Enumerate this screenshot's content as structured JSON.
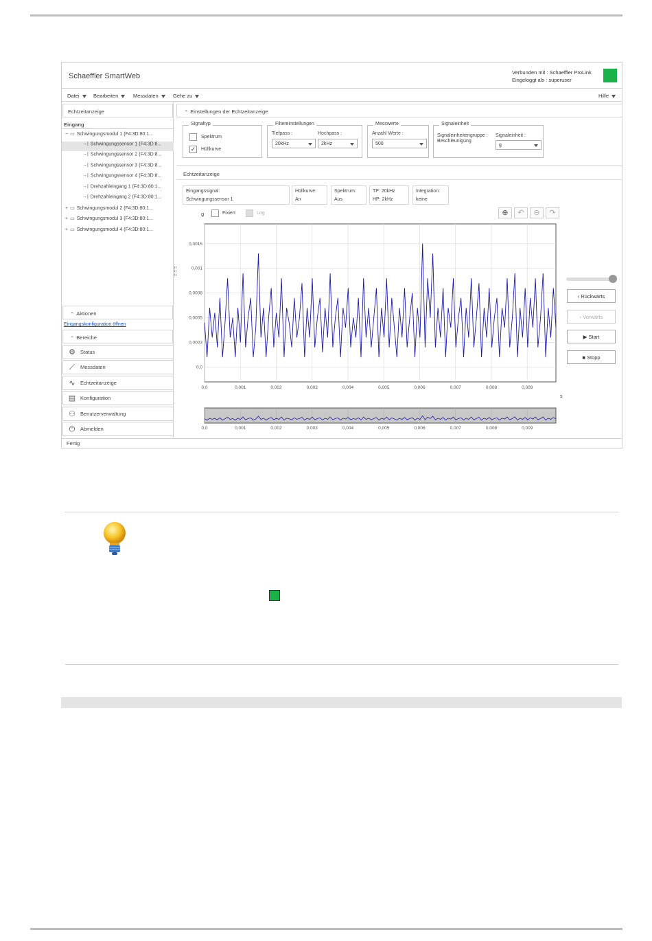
{
  "app": {
    "title": "Schaeffler SmartWeb",
    "connected_label": "Verbunden mit : Schaeffler ProLink",
    "logged_label": "Eingeloggt als : superuser",
    "status_color": "#1bb24a",
    "status_text": "Fertig"
  },
  "menu": {
    "items": [
      "Datei",
      "Bearbeiten",
      "Messdaten",
      "Gehe zu"
    ],
    "help": "Hilfe"
  },
  "left": {
    "header": "Echtzeitanzeige",
    "section": "Eingang",
    "tree": [
      "Schwingungsmodul 1 (F4:3D:80:1...",
      "Schwingungssensor 1 (F4:3D:8...",
      "Schwingungssensor 2 (F4:3D:8...",
      "Schwingungssensor 3 (F4:3D:8...",
      "Schwingungssensor 4 (F4:3D:8...",
      "Drehzahleingang 1 (F4:3D:80:1...",
      "Drehzahleingang 2 (F4:3D:80:1...",
      "Schwingungsmodul 2 (F4:3D:80:1...",
      "Schwingungsmodul 3 (F4:3D:80:1...",
      "Schwingungsmodul 4 (F4:3D:80:1..."
    ],
    "actions": "Aktionen",
    "config_link": "Eingangskonfiguration öffnen",
    "areas": "Bereiche",
    "nav": [
      "Status",
      "Messdaten",
      "Echtzeitanzeige",
      "Konfiguration",
      "Benutzerverwaltung",
      "Abmelden"
    ]
  },
  "settings": {
    "header": "Einstellungen der Echtzeitanzeige",
    "signaltyp": {
      "title": "Signaltyp",
      "spektrum": "Spektrum",
      "huellkurve": "Hüllkurve",
      "spektrum_checked": false,
      "huellkurve_checked": true
    },
    "filter": {
      "title": "Filtereinstellungen",
      "tiefpass_label": "Tiefpass :",
      "tiefpass_value": "20kHz",
      "hochpass_label": "Hochpass :",
      "hochpass_value": "2kHz"
    },
    "messwerte": {
      "title": "Messwerte",
      "anzahl_label": "Anzahl Werte :",
      "anzahl_value": "500"
    },
    "einheit": {
      "title": "Signaleinheit",
      "gruppe_label": "Signaleinheitengruppe :",
      "gruppe_value": "Beschleunigung",
      "einheit_label": "Signaleinheit :",
      "einheit_value": "g"
    }
  },
  "realtime": {
    "header": "Echtzeitanzeige",
    "info": [
      {
        "label": "Eingangssignal:",
        "value": "Schwingungssensor 1"
      },
      {
        "label": "Hüllkurve:",
        "value": "An"
      },
      {
        "label": "Spektrum:",
        "value": "Aus"
      },
      {
        "label": "TP: 20kHz",
        "value": "HP: 2kHz"
      },
      {
        "label": "Integration:",
        "value": "keine"
      }
    ],
    "unit_label": "g",
    "fixiert": "Fixiert",
    "log": "Log",
    "x_unit": "s",
    "buttons": {
      "back": "Rückwärts",
      "forward": "Vorwärts",
      "start": "Start",
      "stop": "Stopp"
    }
  },
  "chart_data": {
    "type": "line",
    "xlabel": "s",
    "ylabel": "g",
    "xlim": [
      0,
      0.0098
    ],
    "ylim": [
      -0.00015,
      0.00145
    ],
    "y_ticks": [
      "0,0015",
      "0,001",
      "0,0008",
      "0,0005",
      "0,0003",
      "0,0"
    ],
    "y_tick_values": [
      0.00125,
      0.001,
      0.00075,
      0.0005,
      0.00025,
      0
    ],
    "x_ticks": [
      "0,0",
      "0,001",
      "0,002",
      "0,003",
      "0,004",
      "0,005",
      "0,006",
      "0,007",
      "0,008",
      "0,009"
    ],
    "x_tick_values": [
      0,
      0.001,
      0.002,
      0.003,
      0.004,
      0.005,
      0.006,
      0.007,
      0.008,
      0.009
    ],
    "grid": true,
    "line_color": "#1a1aa6",
    "series": [
      {
        "values": [
          0.00045,
          0.0001,
          0.0006,
          0.0003,
          0.00055,
          0.0002,
          0.0007,
          0.0001,
          0.00045,
          0.0009,
          0.0003,
          0.0005,
          0.0001,
          0.0006,
          0.00025,
          0.00095,
          0.0002,
          0.0005,
          0.0007,
          0.0001,
          0.0004,
          0.00115,
          0.0003,
          0.0006,
          0.0001,
          0.0005,
          0.0008,
          0.0002,
          0.00055,
          0.0003,
          0.0009,
          0.0001,
          0.0006,
          0.00045,
          0.0002,
          0.0007,
          0.0003,
          0.0005,
          0.00085,
          0.0001,
          0.0006,
          0.0003,
          0.0009,
          0.0002,
          0.0005,
          0.0007,
          0.00015,
          0.0006,
          0.0003,
          0.00095,
          0.0002,
          0.0005,
          0.0007,
          0.0001,
          0.0006,
          0.0004,
          0.0008,
          0.0002,
          0.0005,
          0.0003,
          0.0007,
          0.0001,
          0.0009,
          0.0003,
          0.0006,
          0.0002,
          0.0005,
          0.0008,
          0.0001,
          0.0006,
          0.0003,
          0.0009,
          0.0002,
          0.0007,
          0.0004,
          0.0001,
          0.0006,
          0.0003,
          0.0008,
          0.0002,
          0.0005,
          0.00075,
          0.0001,
          0.0006,
          0.0003,
          0.00125,
          0.0002,
          0.0009,
          0.0005,
          0.00115,
          0.0002,
          0.0006,
          0.0003,
          0.0008,
          0.0001,
          0.0006,
          0.0004,
          0.0009,
          0.0002,
          0.0005,
          0.0007,
          0.0001,
          0.0006,
          0.0003,
          0.0009,
          0.0002,
          0.0005,
          0.00085,
          0.0001,
          0.0006,
          0.0003,
          0.0008,
          0.0002,
          0.0005,
          0.0007,
          0.0001,
          0.0006,
          0.0004,
          0.0009,
          0.0002,
          0.0005,
          0.00095,
          0.0001,
          0.0006,
          0.0003,
          0.0008,
          0.0002,
          0.0007,
          0.0004,
          0.0009,
          0.0002,
          0.0005,
          0.00095,
          0.0001,
          0.0006,
          0.0003,
          0.0008,
          0.0004
        ]
      }
    ]
  },
  "document": {
    "hint_icon": "lightbulb-icon",
    "hint_square_color": "#1bb24a"
  }
}
